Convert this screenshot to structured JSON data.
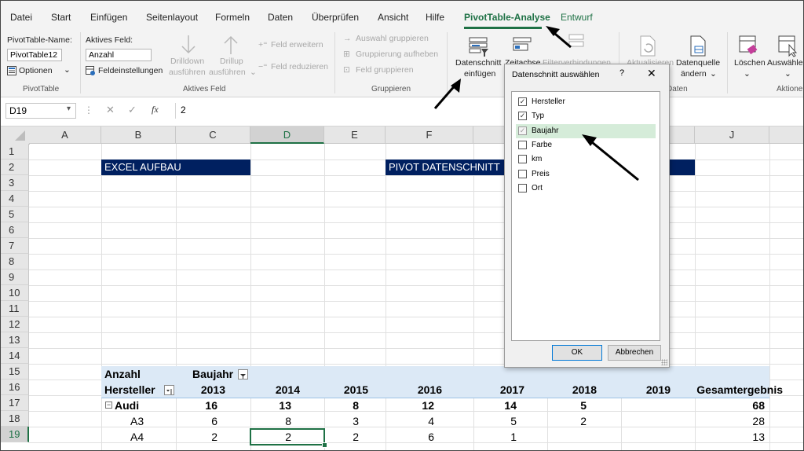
{
  "menu": {
    "tabs": [
      "Datei",
      "Start",
      "Einfügen",
      "Seitenlayout",
      "Formeln",
      "Daten",
      "Überprüfen",
      "Ansicht",
      "Hilfe",
      "PivotTable-Analyse",
      "Entwurf"
    ],
    "active_tab": "PivotTable-Analyse"
  },
  "ribbon": {
    "pivottable": {
      "name_label": "PivotTable-Name:",
      "name_value": "PivotTable12",
      "options_label": "Optionen",
      "group_label": "PivotTable"
    },
    "active_field": {
      "label": "Aktives Feld:",
      "value": "Anzahl",
      "settings_label": "Feldeinstellungen",
      "drilldown_line1": "Drilldown",
      "drilldown_line2": "ausführen",
      "drillup_line1": "Drillup",
      "drillup_line2": "ausführen",
      "expand_label": "Feld erweitern",
      "collapse_label": "Feld reduzieren",
      "group_label": "Aktives Feld"
    },
    "group": {
      "selection_group": "Auswahl gruppieren",
      "ungroup": "Gruppierung aufheben",
      "field_group": "Feld gruppieren",
      "group_label": "Gruppieren"
    },
    "filter": {
      "slicer_line1": "Datenschnitt",
      "slicer_line2": "einfügen",
      "timeline_label": "Zeitachse",
      "filter_conn_label": "Filterverbindungen"
    },
    "data": {
      "refresh_label": "Aktualisieren",
      "source_line1": "Datenquelle",
      "source_line2": "ändern",
      "group_label": "Daten"
    },
    "actions": {
      "clear_label": "Löschen",
      "select_label": "Auswählen",
      "group_label": "Aktionen"
    }
  },
  "formula_bar": {
    "cell_ref": "D19",
    "fx": "fx",
    "value": "2"
  },
  "sheet": {
    "columns": [
      "A",
      "B",
      "C",
      "D",
      "E",
      "F",
      "G",
      "H",
      "I",
      "J"
    ],
    "rows": [
      "1",
      "2",
      "3",
      "4",
      "5",
      "6",
      "7",
      "8",
      "9",
      "10",
      "11",
      "12",
      "13",
      "14",
      "15",
      "16",
      "17",
      "18",
      "19"
    ],
    "banner_left": "EXCEL AUFBAU",
    "banner_right": "PIVOT DATENSCHNITT",
    "pivot": {
      "values_label": "Anzahl",
      "col_field": "Baujahr",
      "row_field": "Hersteller",
      "years": [
        "2013",
        "2014",
        "2015",
        "2016",
        "2017",
        "2018",
        "2019"
      ],
      "total_label": "Gesamtergebnis",
      "rows": [
        {
          "label": "Audi",
          "values": [
            "16",
            "13",
            "8",
            "12",
            "14",
            "5",
            ""
          ],
          "total": "68",
          "bold": true
        },
        {
          "label": "A3",
          "values": [
            "6",
            "8",
            "3",
            "4",
            "5",
            "2",
            ""
          ],
          "total": "28",
          "bold": false
        },
        {
          "label": "A4",
          "values": [
            "2",
            "2",
            "2",
            "6",
            "1",
            "",
            ""
          ],
          "total": "13",
          "bold": false
        }
      ]
    }
  },
  "dialog": {
    "title": "Datenschnitt auswählen",
    "help": "?",
    "close": "✕",
    "items": [
      {
        "label": "Hersteller",
        "checked": true
      },
      {
        "label": "Typ",
        "checked": true
      },
      {
        "label": "Baujahr",
        "checked": true
      },
      {
        "label": "Farbe",
        "checked": false
      },
      {
        "label": "km",
        "checked": false
      },
      {
        "label": "Preis",
        "checked": false
      },
      {
        "label": "Ort",
        "checked": false
      }
    ],
    "ok_label": "OK",
    "cancel_label": "Abbrechen"
  }
}
